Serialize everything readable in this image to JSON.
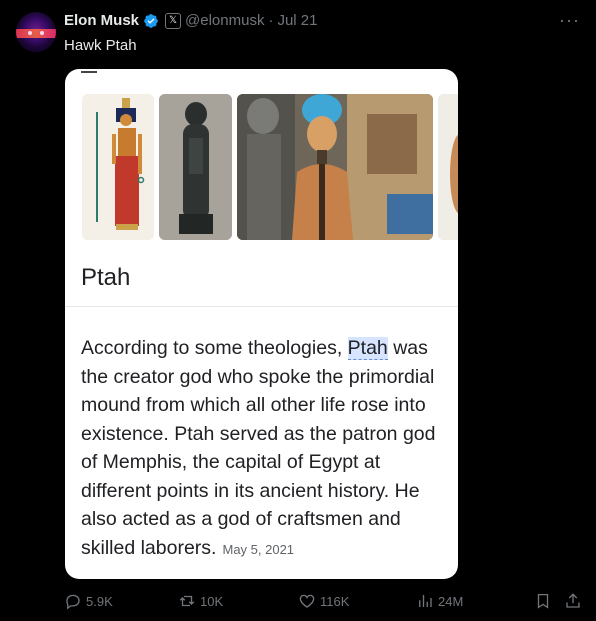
{
  "author": {
    "name": "Elon Musk",
    "handle": "@elonmusk",
    "separator": "·",
    "date": "Jul 21",
    "x_badge": "𝕏"
  },
  "tweet": {
    "text": "Hawk Ptah"
  },
  "card": {
    "title": "Ptah",
    "para_before": "According to some theologies, ",
    "para_highlight": "Ptah",
    "para_after": " was the creator god who spoke the primordial mound from which all other life rose into existence. Ptah served as the patron god of Memphis, the capital of Egypt at different points in its ancient history. He also acted as a god of craftsmen and skilled laborers.",
    "date": "May 5, 2021"
  },
  "actions": {
    "replies": "5.9K",
    "reposts": "10K",
    "likes": "116K",
    "views": "24M"
  },
  "icons": {
    "more": "more-icon",
    "verified": "verified-badge-icon",
    "reply": "reply-icon",
    "repost": "repost-icon",
    "like": "heart-icon",
    "views": "views-chart-icon",
    "bookmark": "bookmark-icon",
    "share": "share-icon"
  },
  "colors": {
    "background": "#000000",
    "text": "#e7e9ea",
    "muted": "#71767b",
    "verified": "#1d9bf0",
    "highlight": "#d6e4ff"
  }
}
